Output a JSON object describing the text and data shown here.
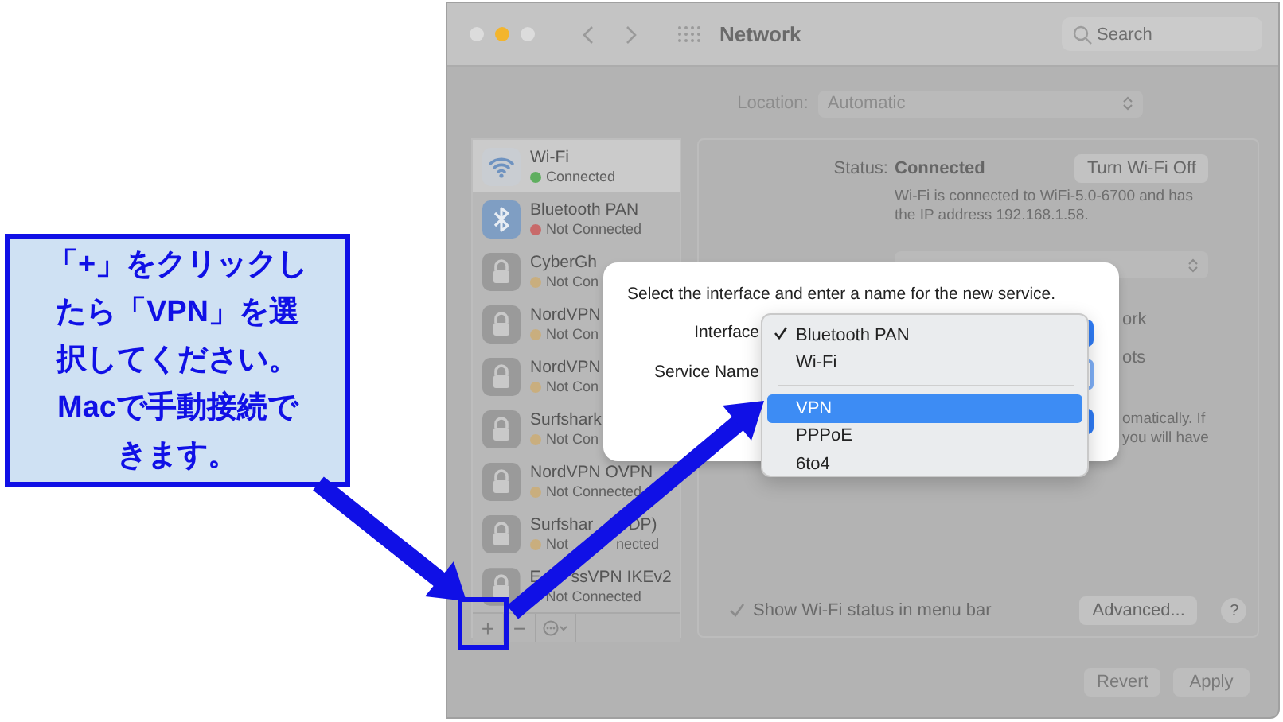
{
  "window": {
    "title": "Network",
    "search": {
      "placeholder": "Search"
    }
  },
  "location": {
    "label": "Location:",
    "value": "Automatic"
  },
  "sidebar": {
    "items": [
      {
        "name": "Wi-Fi",
        "status": "Connected",
        "color": "#5fae5f",
        "kind": "wifi",
        "selected": true
      },
      {
        "name": "Bluetooth PAN",
        "status": "Not Connected",
        "color": "#c86a6a",
        "kind": "bluetooth",
        "selected": false
      },
      {
        "name": "CyberGh",
        "status": "Not Con",
        "color": "#c9ae7e",
        "kind": "lock",
        "selected": false
      },
      {
        "name": "NordVPN",
        "status": "Not Con",
        "color": "#c9ae7e",
        "kind": "lock",
        "selected": false
      },
      {
        "name": "NordVPN",
        "status": "Not Con",
        "color": "#c9ae7e",
        "kind": "lock",
        "selected": false
      },
      {
        "name": "Surfshark.",
        "status": "Not Con",
        "color": "#c9ae7e",
        "kind": "lock",
        "selected": false
      },
      {
        "name": "NordVPN OVPN",
        "status": "Not Connected",
        "color": "#c9ae7e",
        "kind": "lock",
        "selected": false
      },
      {
        "name": "Surfshar",
        "name_end": "DP)",
        "status": "Not",
        "status_end": "nected",
        "color": "#c9ae7e",
        "kind": "lock",
        "selected": false
      },
      {
        "name": "E",
        "name_end": "ssVPN IKEv2",
        "status": "Not Connected",
        "kind": "lock",
        "selected": false
      }
    ],
    "buttons": [
      "+",
      "−"
    ]
  },
  "panel": {
    "status_label": "Status:",
    "status_value": "Connected",
    "toggle_button": "Turn Wi-Fi Off",
    "description": [
      "Wi-Fi is connected to WiFi-5.0-6700 and has",
      "the IP address 192.168.1.58."
    ],
    "partial_texts": [
      "ork",
      "ots",
      "omatically. If",
      "you will have"
    ],
    "checkbox": {
      "label": "Show Wi-Fi status in menu bar",
      "checked": true
    },
    "advanced_button": "Advanced...",
    "help_button": "?"
  },
  "footer_buttons": [
    "Revert",
    "Apply"
  ],
  "dialog": {
    "message": "Select the interface and enter a name for the new service.",
    "interface_label": "Interface",
    "service_label": "Service Name"
  },
  "menu": {
    "items": [
      {
        "label": "Bluetooth PAN",
        "checked": true,
        "selected": false
      },
      {
        "label": "Wi-Fi",
        "checked": false,
        "selected": false
      },
      {
        "kind": "separator"
      },
      {
        "label": "VPN",
        "checked": false,
        "selected": true
      },
      {
        "label": "PPPoE",
        "checked": false,
        "selected": false
      },
      {
        "label": "6to4",
        "checked": false,
        "selected": false
      }
    ]
  },
  "annotation": {
    "lines": [
      "「+」をクリックし",
      "たら「VPN」を選",
      "択してください。",
      "Macで手動接続で",
      "きます。"
    ]
  }
}
